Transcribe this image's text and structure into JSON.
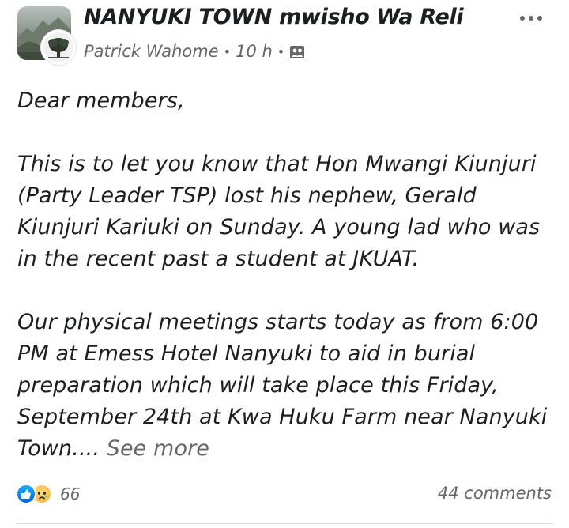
{
  "header": {
    "group_name": "NANYUKI TOWN mwisho Wa Reli",
    "author": "Patrick Wahome",
    "time": "10 h",
    "separator": "•",
    "privacy_icon": "group-members-icon"
  },
  "post": {
    "lines": [
      "Dear members,",
      "",
      "This is to let you know that Hon Mwangi Kiunjuri",
      "(Party Leader TSP) lost his nephew, Gerald",
      "Kiunjuri Kariuki on Sunday. A young lad who was",
      "in the recent past a student at JKUAT.",
      "",
      "Our physical meetings starts today as from 6:00",
      "PM at Emess Hotel Nanyuki to aid in burial",
      "preparation which will take place this Friday,",
      "September 24th at Kwa Huku Farm near Nanyuki"
    ],
    "last_line": "Town....",
    "see_more": "See more"
  },
  "footer": {
    "reaction_count": "66",
    "reactions": [
      "like",
      "sad"
    ],
    "comments": "44 comments"
  },
  "colors": {
    "text": "#1c1e21",
    "muted": "#65676b",
    "like_blue": "#1877f2"
  }
}
